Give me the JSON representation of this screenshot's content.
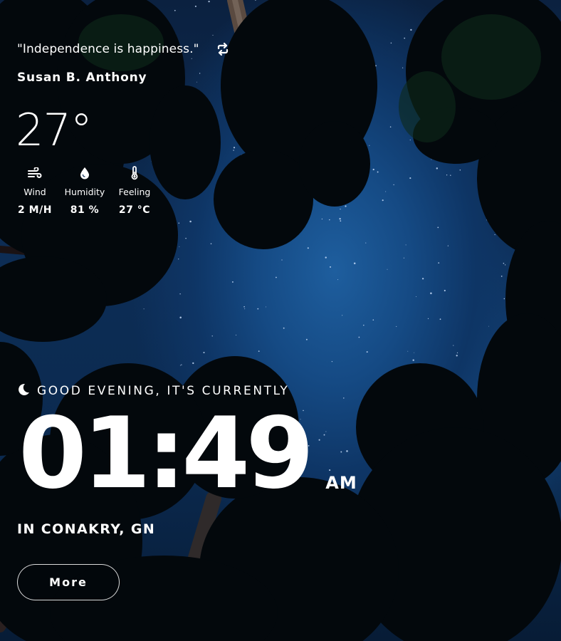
{
  "quote": {
    "text": "\"Independence is happiness.\"",
    "author": "Susan B. Anthony",
    "refresh_icon": "refresh-icon"
  },
  "weather": {
    "temperature": "27°",
    "stats": [
      {
        "icon": "wind-icon",
        "label": "Wind",
        "value": "2 M/H"
      },
      {
        "icon": "humidity-drop-icon",
        "label": "Humidity",
        "value": "81 %"
      },
      {
        "icon": "thermometer-icon",
        "label": "Feeling",
        "value": "27 °C"
      }
    ]
  },
  "greeting": {
    "icon": "moon-icon",
    "text": "GOOD EVENING, IT'S CURRENTLY"
  },
  "clock": {
    "time": "01:49",
    "period": "AM"
  },
  "location": "IN CONAKRY, GN",
  "more_button": {
    "label": "More"
  },
  "colors": {
    "text": "#ffffff",
    "sky": "#154a84",
    "foliage": "#03080c"
  }
}
